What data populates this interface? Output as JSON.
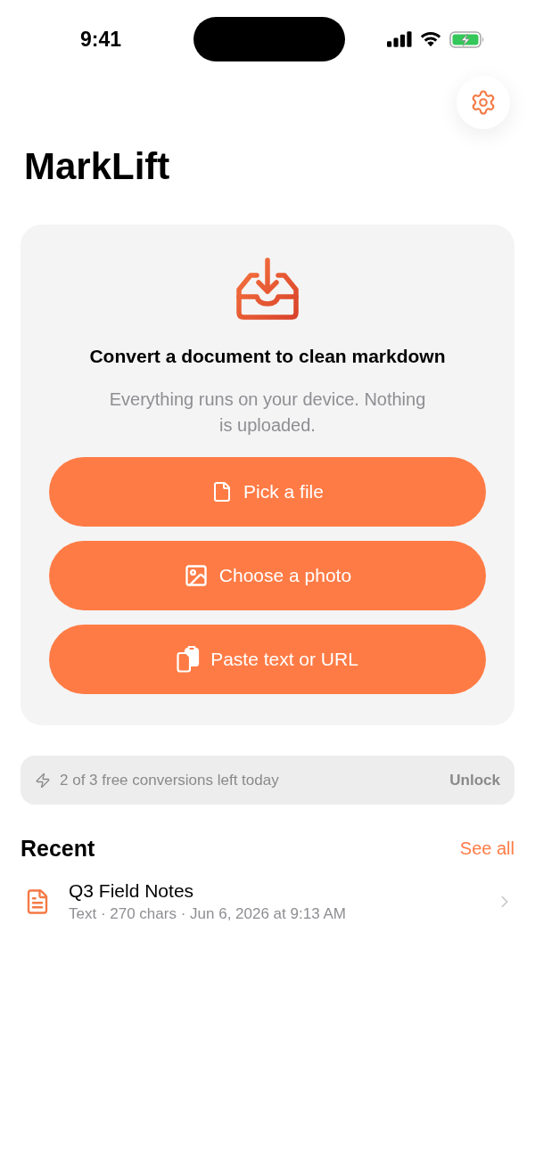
{
  "status_bar": {
    "time": "9:41"
  },
  "header": {
    "title": "MarkLift"
  },
  "import_card": {
    "heading": "Convert a document to clean markdown",
    "subtitle": "Everything runs on your device. Nothing is uploaded.",
    "actions": [
      {
        "kind": "file",
        "label": "Pick a file"
      },
      {
        "kind": "photo",
        "label": "Choose a photo"
      },
      {
        "kind": "paste",
        "label": "Paste text or URL"
      }
    ]
  },
  "quota_banner": {
    "text": "2 of 3 free conversions left today",
    "action": "Unlock"
  },
  "recent": {
    "title": "Recent",
    "see_all": "See all",
    "items": [
      {
        "title": "Q3 Field Notes",
        "meta": "Text · 270 chars · Jun 6, 2026 at 9:13 AM"
      }
    ]
  }
}
